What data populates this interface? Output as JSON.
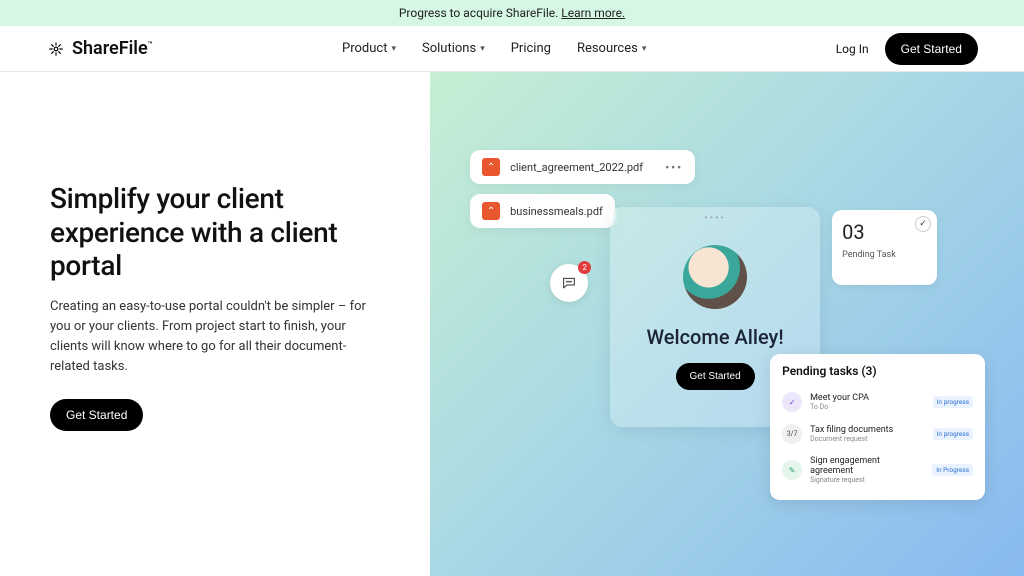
{
  "announcement": {
    "text": "Progress to acquire ShareFile. ",
    "link": "Learn more."
  },
  "brand": "ShareFile",
  "nav": {
    "items": [
      "Product",
      "Solutions",
      "Pricing",
      "Resources"
    ],
    "login": "Log In",
    "cta": "Get Started"
  },
  "hero": {
    "headline": "Simplify your client experience with a client portal",
    "sub": "Creating an easy-to-use portal couldn't be simpler – for you or your clients. From project start to finish, your clients will know where to go for all their document-related tasks.",
    "cta": "Get Started"
  },
  "deco": {
    "file1": "client_agreement_2022.pdf",
    "file2": "businessmeals.pdf",
    "chat_badge": "2",
    "pending_num": "03",
    "pending_label": "Pending Task",
    "welcome": "Welcome Alley!",
    "welcome_cta": "Get Started",
    "tasks_title": "Pending tasks (3)",
    "tasks": [
      {
        "ico": "✓",
        "title": "Meet your CPA",
        "sub": "To Do",
        "badge": "In progress"
      },
      {
        "ico": "3/7",
        "title": "Tax filing documents",
        "sub": "Document request",
        "badge": "In progress"
      },
      {
        "ico": "✎",
        "title": "Sign engagement agreement",
        "sub": "Signature request",
        "badge": "In Progress"
      }
    ]
  }
}
